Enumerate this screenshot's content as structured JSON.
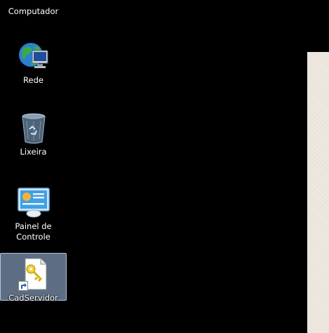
{
  "desktop": {
    "icons": [
      {
        "label": "Computador",
        "icon": "computer-icon"
      },
      {
        "label": "Rede",
        "icon": "network-globe-icon"
      },
      {
        "label": "Lixeira",
        "icon": "recycle-bin-icon"
      },
      {
        "label": "Painel de\nControle",
        "icon": "control-panel-icon"
      },
      {
        "label": "CadServidor",
        "icon": "key-file-shortcut-icon",
        "selected": true
      }
    ]
  },
  "colors": {
    "background": "#000000",
    "selection": "#aac8f0",
    "side_panel": "#efe9e1"
  }
}
